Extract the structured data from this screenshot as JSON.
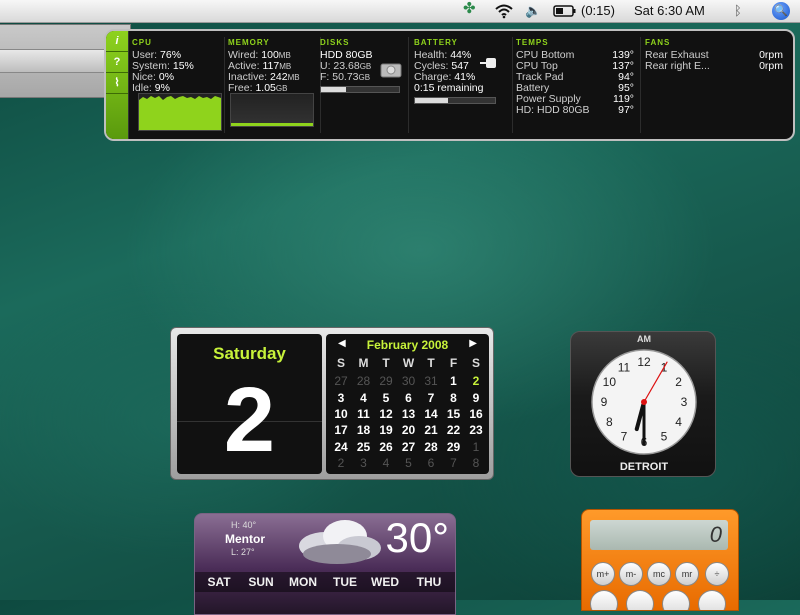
{
  "menubar": {
    "battery_time": "(0:15)",
    "clock": "Sat 6:30 AM",
    "icons": [
      "leaf-icon",
      "wifi-icon",
      "volume-icon",
      "battery-icon",
      "bluetooth-icon",
      "spotlight-icon"
    ]
  },
  "istat": {
    "side_buttons": [
      "i",
      "?",
      "pulse-icon"
    ],
    "cpu": {
      "title": "CPU",
      "rows": [
        {
          "k": "User:",
          "v": "76%"
        },
        {
          "k": "System:",
          "v": "15%"
        },
        {
          "k": "Nice:",
          "v": "0%"
        },
        {
          "k": "Idle:",
          "v": "9%"
        }
      ]
    },
    "memory": {
      "title": "MEMORY",
      "rows": [
        {
          "k": "Wired:",
          "v": "100",
          "u": "MB"
        },
        {
          "k": "Active:",
          "v": "117",
          "u": "MB"
        },
        {
          "k": "Inactive:",
          "v": "242",
          "u": "MB"
        },
        {
          "k": "Free:",
          "v": "1.05",
          "u": "GB"
        }
      ]
    },
    "disks": {
      "title": "DISKS",
      "name": "HDD 80GB",
      "used": "U: 23.68",
      "used_u": "GB",
      "free": "F: 50.73",
      "free_u": "GB",
      "used_fraction": 0.32
    },
    "battery": {
      "title": "BATTERY",
      "rows": [
        {
          "k": "Health:",
          "v": "44%"
        },
        {
          "k": "Cycles:",
          "v": "547"
        },
        {
          "k": "Charge:",
          "v": "41%"
        }
      ],
      "remaining": "0:15 remaining",
      "charge_fraction": 0.41
    },
    "temps": {
      "title": "TEMPS",
      "rows": [
        {
          "k": "CPU Bottom",
          "v": "139°"
        },
        {
          "k": "CPU Top",
          "v": "137°"
        },
        {
          "k": "Track Pad",
          "v": "94°"
        },
        {
          "k": "Battery",
          "v": "95°"
        },
        {
          "k": "Power Supply",
          "v": "119°"
        },
        {
          "k": "HD: HDD 80GB",
          "v": "97°"
        }
      ]
    },
    "fans": {
      "title": "FANS",
      "rows": [
        {
          "k": "Rear Exhaust",
          "v": "0rpm"
        },
        {
          "k": "Rear right E...",
          "v": "0rpm"
        }
      ]
    }
  },
  "calendar": {
    "day_name": "Saturday",
    "day_number": "2",
    "month_title": "February 2008",
    "weekdays": [
      "S",
      "M",
      "T",
      "W",
      "T",
      "F",
      "S"
    ],
    "weeks": [
      [
        "27",
        "28",
        "29",
        "30",
        "31",
        "1",
        "2"
      ],
      [
        "3",
        "4",
        "5",
        "6",
        "7",
        "8",
        "9"
      ],
      [
        "10",
        "11",
        "12",
        "13",
        "14",
        "15",
        "16"
      ],
      [
        "17",
        "18",
        "19",
        "20",
        "21",
        "22",
        "23"
      ],
      [
        "24",
        "25",
        "26",
        "27",
        "28",
        "29",
        "1"
      ],
      [
        "2",
        "3",
        "4",
        "5",
        "6",
        "7",
        "8"
      ]
    ],
    "dim_first_row_count": 5,
    "today_index": [
      0,
      6
    ]
  },
  "clock": {
    "ampm": "AM",
    "city": "DETROIT",
    "hour": 6,
    "minute": 30,
    "second": 5,
    "numerals": [
      "12",
      "1",
      "2",
      "3",
      "4",
      "5",
      "6",
      "7",
      "8",
      "9",
      "10",
      "11"
    ]
  },
  "weather": {
    "high": "H: 40°",
    "city": "Mentor",
    "low": "L: 27°",
    "temp": "30°",
    "days": [
      "SAT",
      "SUN",
      "MON",
      "TUE",
      "WED",
      "THU"
    ]
  },
  "calculator": {
    "display": "0",
    "buttons": [
      "m+",
      "m-",
      "mc",
      "mr",
      "÷"
    ]
  }
}
